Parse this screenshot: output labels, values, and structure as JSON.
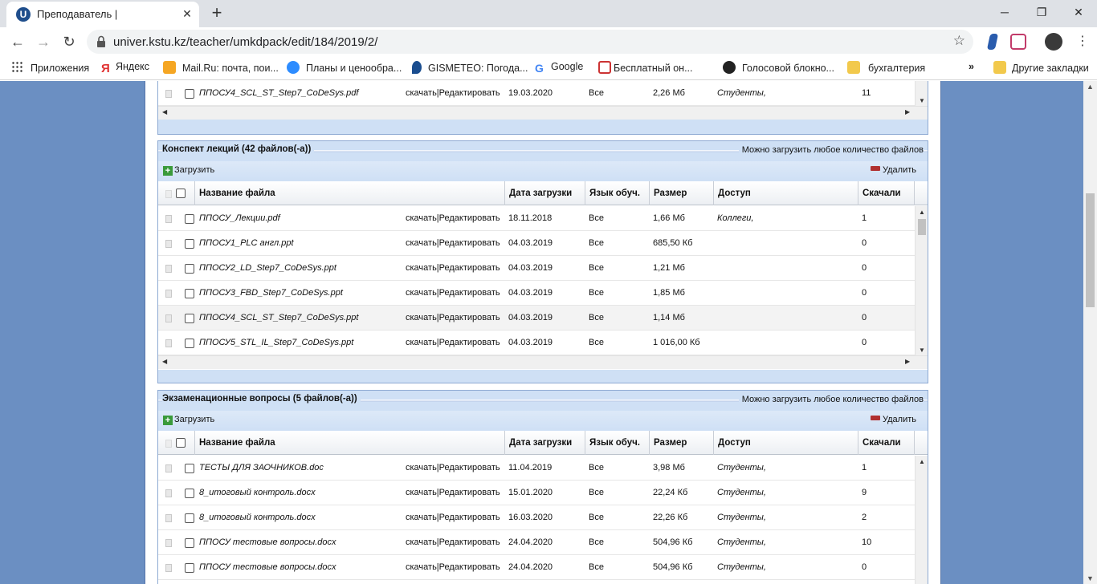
{
  "browser": {
    "tab_title": "Преподаватель |",
    "tab_favicon_letter": "U",
    "url": "univer.kstu.kz/teacher/umkdpack/edit/184/2019/2/",
    "bookmarks": [
      {
        "label": "Приложения",
        "icon": "apps-grid-icon",
        "color": "#4a4a4a"
      },
      {
        "label": "Яндекс",
        "icon": "yandex-icon",
        "color": "#e03030"
      },
      {
        "label": "Mail.Ru: почта, пои...",
        "icon": "mailru-icon",
        "color": "#f5a623"
      },
      {
        "label": "Планы и ценообра...",
        "icon": "zoom-icon",
        "color": "#2d8cff"
      },
      {
        "label": "GISMETEO: Погода...",
        "icon": "gismeteo-icon",
        "color": "#1a4d8f"
      },
      {
        "label": "Google",
        "icon": "google-icon",
        "color": "#4285f4"
      },
      {
        "label": "Бесплатный он...",
        "icon": "chat-icon",
        "color": "#cc3333"
      },
      {
        "label": "Голосовой блокно...",
        "icon": "globe-icon",
        "color": "#222222"
      },
      {
        "label": "бухгалтерия",
        "icon": "folder-icon",
        "color": "#f2c94c"
      }
    ],
    "more_bookmarks": "»",
    "other_bookmarks": "Другие закладки"
  },
  "columns": {
    "name": "Название файла",
    "date": "Дата загрузки",
    "lang": "Язык обуч.",
    "size": "Размер",
    "access": "Доступ",
    "downloads": "Скачали"
  },
  "top_partial_row": {
    "name": "ППОСУ4_SCL_ST_Step7_CoDeSys.pdf",
    "actions": "скачать|Редактировать",
    "date": "19.03.2020",
    "lang": "Все",
    "size": "2,26 Мб",
    "access": "Студенты,",
    "downloads": "11"
  },
  "sections": [
    {
      "title": "Конспект лекций (42 файлов(-а))",
      "note": "Можно загрузить любое количество файлов",
      "upload_label": "Загрузить",
      "delete_label": "Удалить",
      "rows": [
        {
          "name": "ППОСУ_Лекции.pdf",
          "actions": "скачать|Редактировать",
          "date": "18.11.2018",
          "lang": "Все",
          "size": "1,66 Мб",
          "access": "Коллеги,",
          "downloads": "1"
        },
        {
          "name": "ППОСУ1_PLC англ.ppt",
          "actions": "скачать|Редактировать",
          "date": "04.03.2019",
          "lang": "Все",
          "size": "685,50 Кб",
          "access": "",
          "downloads": "0"
        },
        {
          "name": "ППОСУ2_LD_Step7_CoDeSys.ppt",
          "actions": "скачать|Редактировать",
          "date": "04.03.2019",
          "lang": "Все",
          "size": "1,21 Мб",
          "access": "",
          "downloads": "0"
        },
        {
          "name": "ППОСУ3_FBD_Step7_CoDeSys.ppt",
          "actions": "скачать|Редактировать",
          "date": "04.03.2019",
          "lang": "Все",
          "size": "1,85 Мб",
          "access": "",
          "downloads": "0"
        },
        {
          "name": "ППОСУ4_SCL_ST_Step7_CoDeSys.ppt",
          "actions": "скачать|Редактировать",
          "date": "04.03.2019",
          "lang": "Все",
          "size": "1,14 Мб",
          "access": "",
          "downloads": "0"
        },
        {
          "name": "ППОСУ5_STL_IL_Step7_CoDeSys.ppt",
          "actions": "скачать|Редактировать",
          "date": "04.03.2019",
          "lang": "Все",
          "size": "1 016,00 Кб",
          "access": "",
          "downloads": "0"
        }
      ]
    },
    {
      "title": "Экзаменационные вопросы (5 файлов(-а))",
      "note": "Можно загрузить любое количество файлов",
      "upload_label": "Загрузить",
      "delete_label": "Удалить",
      "rows": [
        {
          "name": "ТЕСТЫ ДЛЯ ЗАОЧНИКОВ.doc",
          "actions": "скачать|Редактировать",
          "date": "11.04.2019",
          "lang": "Все",
          "size": "3,98 Мб",
          "access": "Студенты,",
          "downloads": "1"
        },
        {
          "name": "8_итоговый контроль.docx",
          "actions": "скачать|Редактировать",
          "date": "15.01.2020",
          "lang": "Все",
          "size": "22,24 Кб",
          "access": "Студенты,",
          "downloads": "9"
        },
        {
          "name": "8_итоговый контроль.docx",
          "actions": "скачать|Редактировать",
          "date": "16.03.2020",
          "lang": "Все",
          "size": "22,26 Кб",
          "access": "Студенты,",
          "downloads": "2"
        },
        {
          "name": "ППОСУ тестовые вопросы.docx",
          "actions": "скачать|Редактировать",
          "date": "24.04.2020",
          "lang": "Все",
          "size": "504,96 Кб",
          "access": "Студенты,",
          "downloads": "10"
        },
        {
          "name": "ППОСУ тестовые вопросы.docx",
          "actions": "скачать|Редактировать",
          "date": "24.04.2020",
          "lang": "Все",
          "size": "504,96 Кб",
          "access": "Студенты,",
          "downloads": "0"
        }
      ]
    }
  ]
}
